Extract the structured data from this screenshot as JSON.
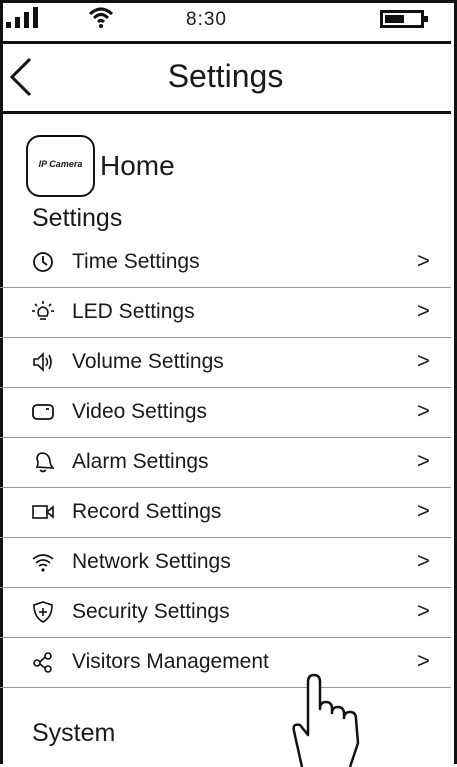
{
  "status_bar": {
    "time": "8:30",
    "signal_icon": "signal-bars-icon",
    "wifi_icon": "wifi-icon",
    "battery_icon": "battery-icon",
    "battery_level": 0.55
  },
  "header": {
    "title": "Settings",
    "back_icon": "chevron-left-icon"
  },
  "home": {
    "camera_icon_text": "IP Camera",
    "label": "Home"
  },
  "sections": {
    "settings": "Settings",
    "system": "System"
  },
  "settings_items": [
    {
      "label": "Time Settings",
      "icon": "clock-icon"
    },
    {
      "label": "LED Settings",
      "icon": "bulb-icon"
    },
    {
      "label": "Volume Settings",
      "icon": "speaker-icon"
    },
    {
      "label": "Video Settings",
      "icon": "video-screen-icon"
    },
    {
      "label": "Alarm Settings",
      "icon": "bell-icon"
    },
    {
      "label": "Record Settings",
      "icon": "video-camera-icon"
    },
    {
      "label": "Network Settings",
      "icon": "wifi-icon"
    },
    {
      "label": "Security Settings",
      "icon": "shield-icon"
    },
    {
      "label": "Visitors Management",
      "icon": "share-icon"
    }
  ],
  "chevron_char": ">",
  "overlay": {
    "icon": "pointing-hand-icon"
  }
}
